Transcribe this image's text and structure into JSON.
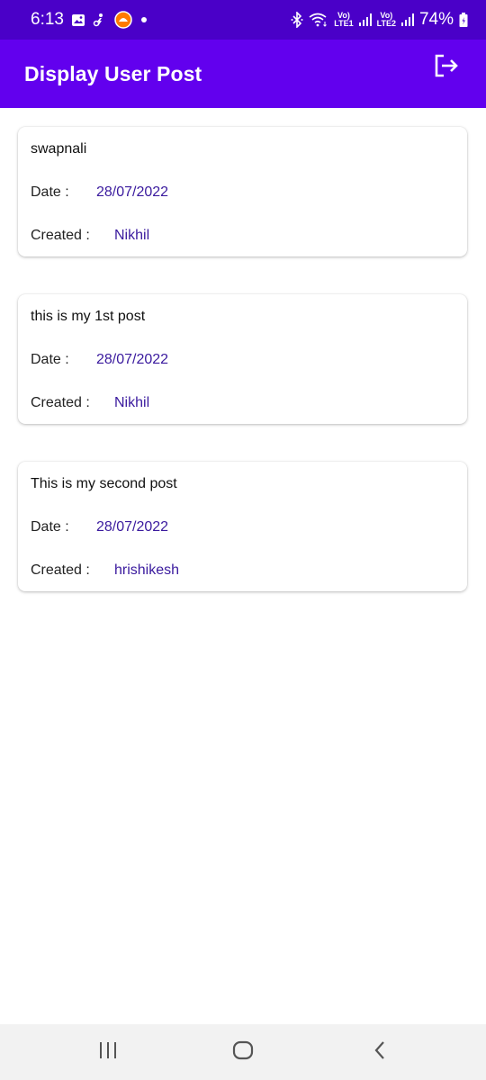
{
  "status_bar": {
    "time": "6:13",
    "net1_top": "Vo)",
    "net1_bottom": "LTE1",
    "net2_top": "Vo)",
    "net2_bottom": "LTE2",
    "battery": "74%",
    "icons": [
      "gallery-icon",
      "fitness-icon",
      "app-notification-icon",
      "dot-icon",
      "bluetooth-icon",
      "wifi-icon",
      "signal-icon",
      "battery-icon"
    ]
  },
  "app_bar": {
    "title": "Display User Post",
    "action_icon": "logout-icon"
  },
  "posts": [
    {
      "title": "swapnali",
      "date_label": "Date :",
      "date": "28/07/2022",
      "created_label": "Created :",
      "created_by": "Nikhil"
    },
    {
      "title": "this is my 1st post",
      "date_label": "Date :",
      "date": "28/07/2022",
      "created_label": "Created :",
      "created_by": "Nikhil"
    },
    {
      "title": "This is my second post",
      "date_label": "Date :",
      "date": "28/07/2022",
      "created_label": "Created :",
      "created_by": "hrishikesh"
    }
  ],
  "nav_bar": {
    "icons": [
      "recents-icon",
      "home-icon",
      "back-icon"
    ]
  },
  "colors": {
    "status_bar": "#4a00c8",
    "app_bar": "#6200ee",
    "value_text": "#3a1a9e",
    "nav_bar": "#f2f2f2"
  }
}
